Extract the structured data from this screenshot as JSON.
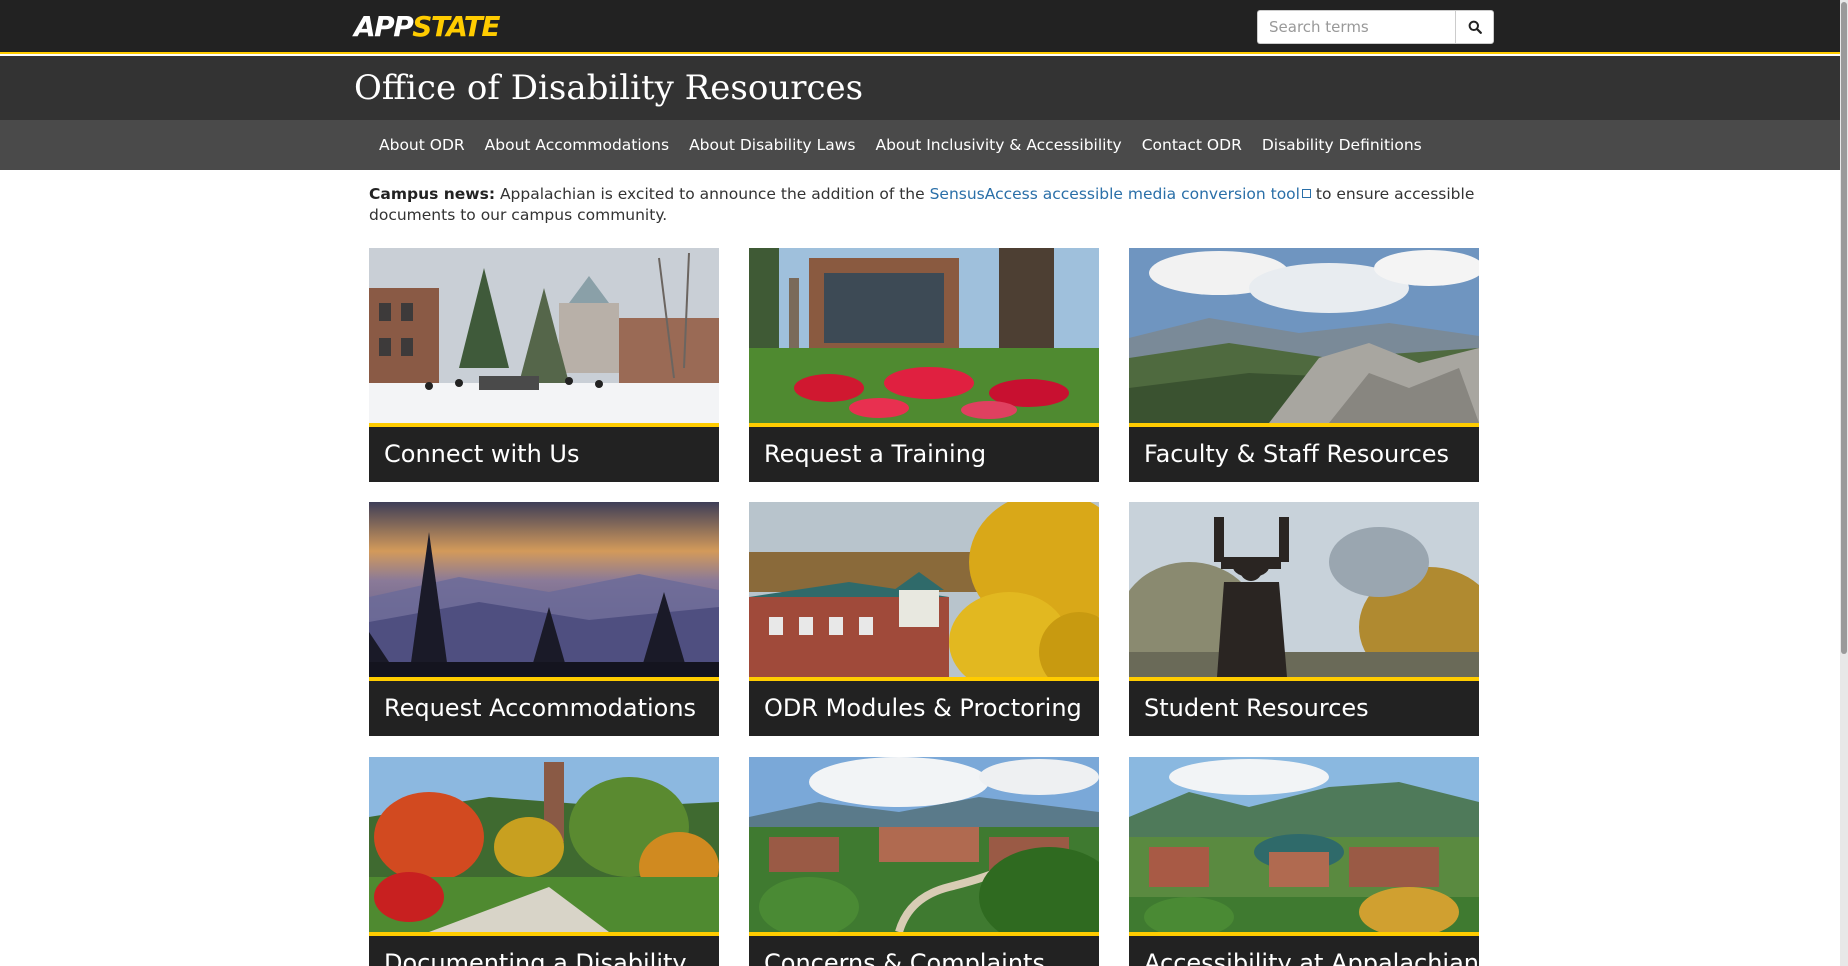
{
  "header": {
    "logo_left": "APP",
    "logo_right": "STATE",
    "search_placeholder": "Search terms",
    "search_icon": "search-icon",
    "accent_color": "#ffcc00"
  },
  "site": {
    "title": "Office of Disability Resources"
  },
  "nav": {
    "items": [
      {
        "label": "About ODR"
      },
      {
        "label": "About Accommodations"
      },
      {
        "label": "About Disability Laws"
      },
      {
        "label": "About Inclusivity & Accessibility"
      },
      {
        "label": "Contact ODR"
      },
      {
        "label": "Disability Definitions"
      }
    ]
  },
  "news": {
    "lead": "Campus news:",
    "text_before": " Appalachian is excited to announce the addition of the ",
    "link_text": "SensusAccess accessible media conversion tool",
    "text_after": " to ensure accessible documents to our campus community."
  },
  "cards": [
    {
      "label": "Connect with Us",
      "image": "snowy-campus-photo"
    },
    {
      "label": "Request a Training",
      "image": "red-tulips-building-photo"
    },
    {
      "label": "Faculty & Staff Resources",
      "image": "mountain-overlook-photo"
    },
    {
      "label": "Request Accommodations",
      "image": "sunset-ridges-photo"
    },
    {
      "label": "ODR Modules & Proctoring",
      "image": "autumn-leaves-building-photo"
    },
    {
      "label": "Student Resources",
      "image": "yosef-statue-photo"
    },
    {
      "label": "Documenting a Disability",
      "image": "bell-tower-autumn-photo"
    },
    {
      "label": "Concerns & Complaints",
      "image": "campus-aerial-photo"
    },
    {
      "label": "Accessibility at Appalachian",
      "image": "campus-mountain-aerial-photo"
    }
  ]
}
